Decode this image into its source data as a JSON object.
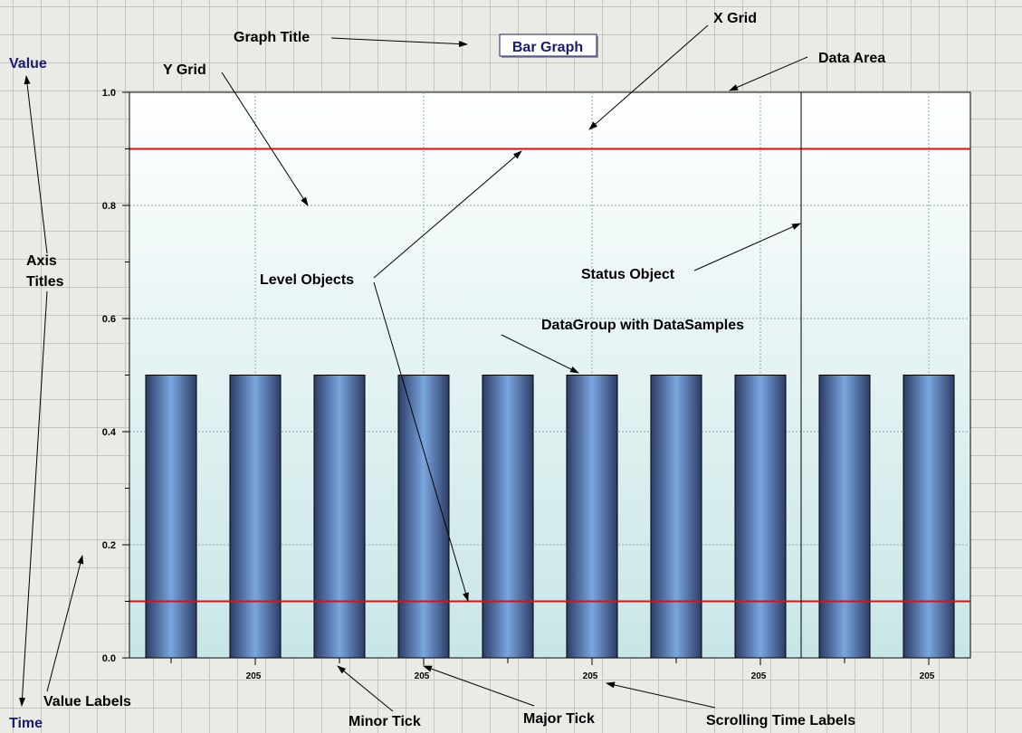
{
  "chart_data": {
    "type": "bar",
    "title": "Bar Graph",
    "ylabel": "Value",
    "xlabel": "Time",
    "ylim": [
      0,
      1.0
    ],
    "yticks": [
      0.0,
      0.2,
      0.4,
      0.6,
      0.8,
      1.0
    ],
    "ytick_labels": [
      "0.0",
      "0.2",
      "0.4",
      "0.6",
      "0.8",
      "1.0"
    ],
    "x_tick_labels": [
      "205",
      "205",
      "205",
      "205",
      "205"
    ],
    "values": [
      0.5,
      0.5,
      0.5,
      0.5,
      0.5,
      0.5,
      0.5,
      0.5,
      0.5,
      0.5
    ],
    "levels": [
      0.9,
      0.1
    ],
    "grid": true,
    "colors": {
      "bar_dark": "#2c3c66",
      "bar_light": "#7aa6e0",
      "level_line": "#e01010",
      "area_top": "#ffffff",
      "area_bottom": "#c8e6e6",
      "axis_title": "#1a1a6e"
    }
  },
  "annotations": {
    "graph_title": "Graph Title",
    "x_grid": "X Grid",
    "y_grid": "Y Grid",
    "data_area": "Data Area",
    "axis_titles": [
      "Axis",
      "Titles"
    ],
    "level_objects": "Level Objects",
    "status_object": "Status Object",
    "datagroup": "DataGroup with DataSamples",
    "value_labels": "Value Labels",
    "minor_tick": "Minor Tick",
    "major_tick": "Major Tick",
    "scrolling_time_labels": "Scrolling Time Labels"
  }
}
